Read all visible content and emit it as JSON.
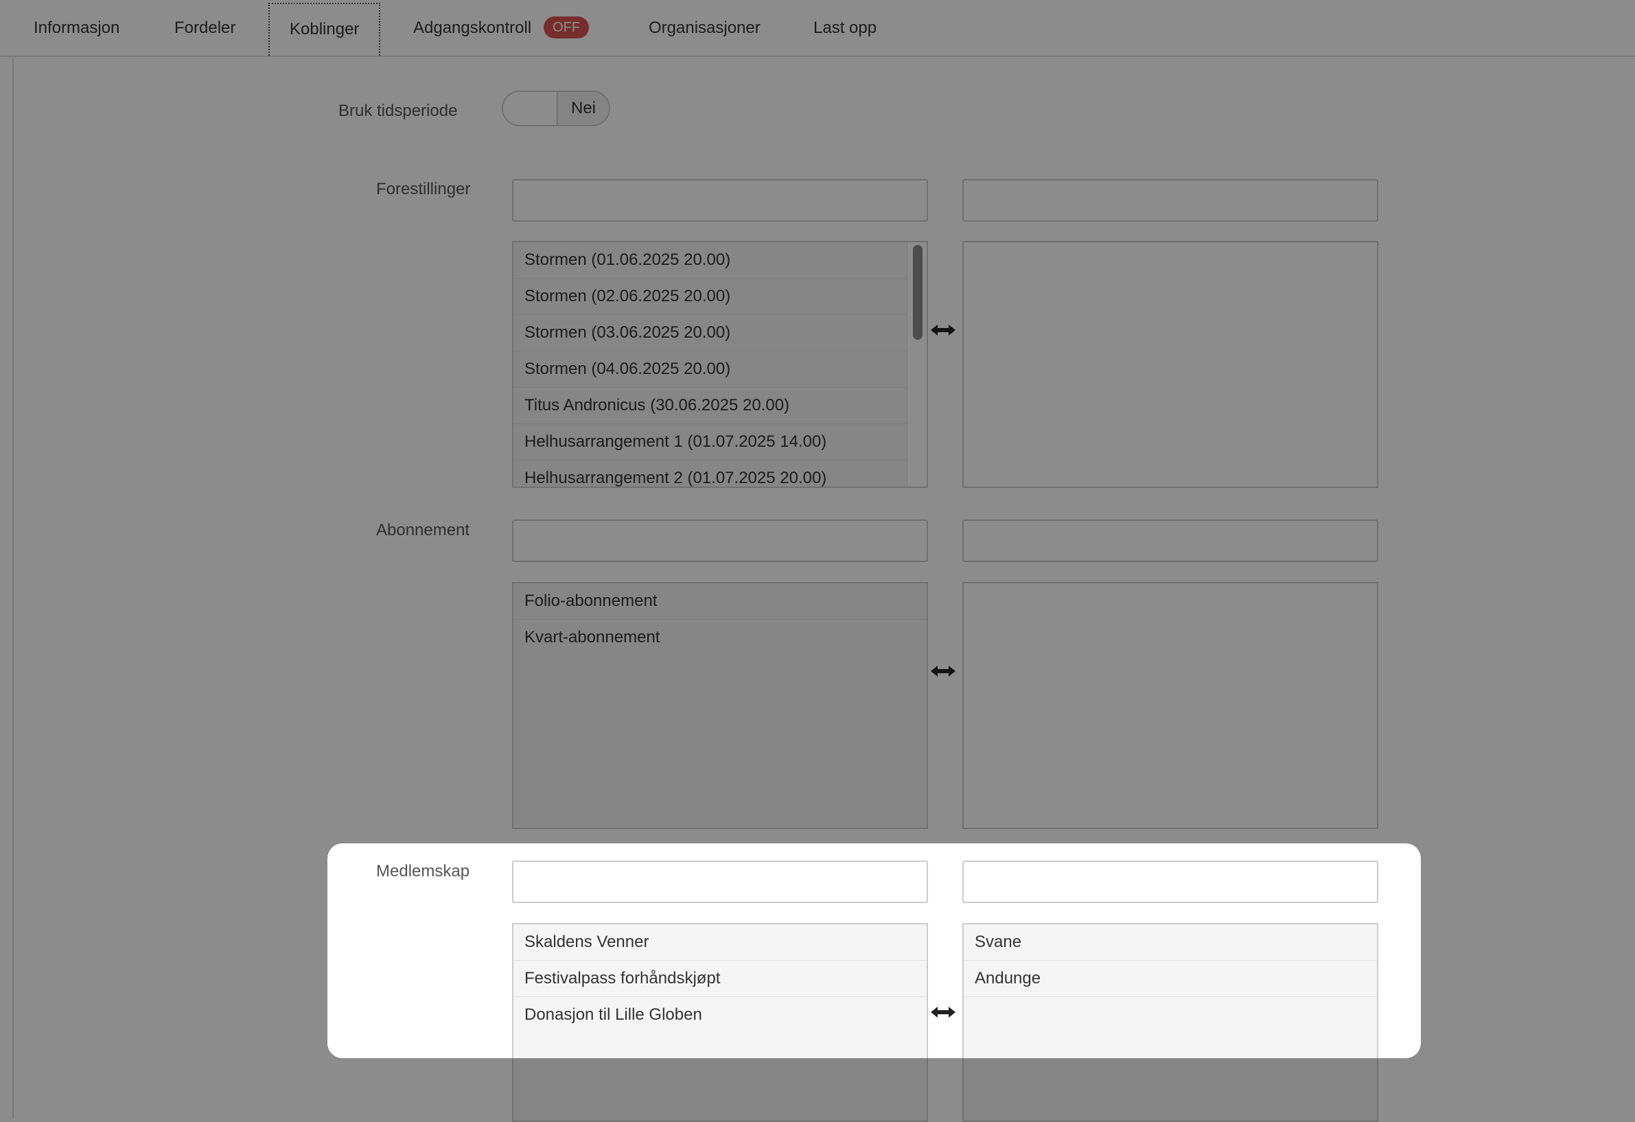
{
  "tabs": [
    {
      "label": "Informasjon"
    },
    {
      "label": "Fordeler"
    },
    {
      "label": "Koblinger"
    },
    {
      "label": "Adgangskontroll",
      "badge": "OFF"
    },
    {
      "label": "Organisasjoner"
    },
    {
      "label": "Last opp"
    }
  ],
  "active_tab": "Koblinger",
  "time_period": {
    "label": "Bruk tidsperiode",
    "toggle_value": "Nei"
  },
  "sections": {
    "forestillinger": {
      "label": "Forestillinger",
      "available": [
        "Stormen (01.06.2025 20.00)",
        "Stormen (02.06.2025 20.00)",
        "Stormen (03.06.2025 20.00)",
        "Stormen (04.06.2025 20.00)",
        "Titus Andronicus (30.06.2025 20.00)",
        "Helhusarrangement 1 (01.07.2025 14.00)",
        "Helhusarrangement 2 (01.07.2025 20.00)"
      ],
      "selected": []
    },
    "abonnement": {
      "label": "Abonnement",
      "available": [
        "Folio-abonnement",
        "Kvart-abonnement"
      ],
      "selected": []
    },
    "medlemskap": {
      "label": "Medlemskap",
      "available": [
        "Skaldens Venner",
        "Festivalpass forhåndskjøpt",
        "Donasjon til Lille Globen"
      ],
      "selected": [
        "Svane",
        "Andunge"
      ]
    }
  },
  "colors": {
    "badge": "#d9534f",
    "overlay": "rgba(0,0,0,0.45)"
  }
}
